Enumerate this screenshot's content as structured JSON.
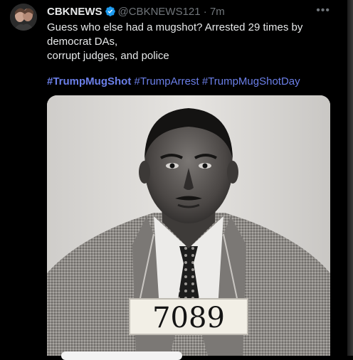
{
  "tweet": {
    "author_name": "CBKNEWS",
    "handle": "@CBKNEWS121",
    "separator": "·",
    "time": "7m",
    "more_label": "•••",
    "text_line1": "Guess who else had a mugshot? Arrested 29 times by",
    "text_line2": "democrat DAs,",
    "text_line3": "corrupt judges, and police",
    "hashtags": [
      "#TrumpMugShot",
      "#TrumpArrest",
      "#TrumpMugShotDay"
    ]
  },
  "photo": {
    "placard_number": "7089"
  },
  "colors": {
    "background": "#000000",
    "text": "#e7e9ea",
    "muted": "#71767b",
    "hashtag": "#6b7fe8",
    "verified": "#1d9bf0"
  },
  "icons": {
    "verified": "verified-badge-icon",
    "more": "more-options-icon"
  }
}
